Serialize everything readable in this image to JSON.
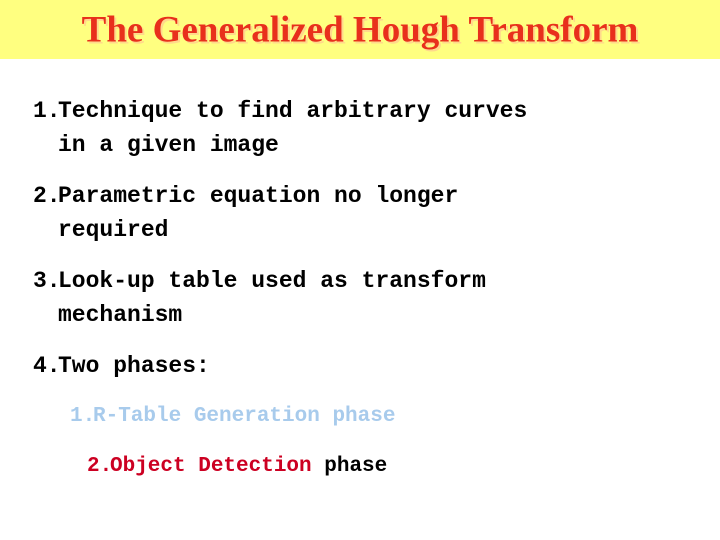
{
  "slide": {
    "title": "The Generalized Hough Transform",
    "title_color": "#e8301c",
    "banner_color": "#ffff80",
    "background_color": "#ffffff"
  },
  "body": {
    "items": [
      {
        "marker": "1.",
        "line1": "Technique to find arbitrary curves",
        "line2": "in a given image"
      },
      {
        "marker": "2.",
        "line1": "Parametric equation no longer",
        "line2": "required"
      },
      {
        "marker": "3.",
        "line1": "Look-up table used as transform",
        "line2": "mechanism"
      },
      {
        "marker": "4.",
        "line1": "Two phases:",
        "line2": ""
      }
    ],
    "sub_items": [
      {
        "marker": "1.",
        "text_colored": "R-Table Generation phase",
        "text_plain": "",
        "color": "#a8cbec"
      },
      {
        "marker": "2.",
        "text_colored": "Object Detection",
        "text_plain": " phase",
        "color": "#cc0022"
      }
    ]
  }
}
